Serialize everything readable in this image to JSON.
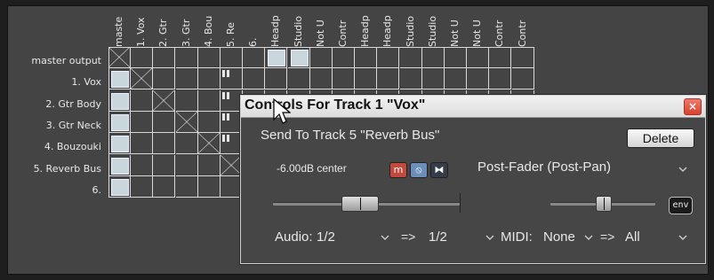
{
  "matrix": {
    "columns": [
      "maste",
      "1. Vox",
      "2. Gtr",
      "3. Gtr",
      "4. Bou",
      "5. Re",
      "6.",
      "Headp",
      "Studio",
      "Not U",
      "Contr",
      "Headp",
      "Headp",
      "Studio",
      "Studio",
      "Not U",
      "Not U",
      "Contr",
      "Contr"
    ],
    "rows": [
      "master output",
      "1. Vox",
      "2. Gtr Body",
      "3. Gtr Neck",
      "4. Bouzouki",
      "5. Reverb Bus",
      "6."
    ]
  },
  "dialog": {
    "title": "Controls For Track 1 \"Vox\"",
    "close_label": "×",
    "send_to": "Send To Track 5 \"Reverb Bus\"",
    "delete_label": "Delete",
    "volume_pan_readout": "-6.00dB center",
    "mute_label": "m",
    "phase_label": "⦸",
    "mono_label": "⧓",
    "send_mode": "Post-Fader (Post-Pan)",
    "env_label": "env",
    "audio_label": "Audio:",
    "audio_source": "1/2",
    "audio_arrow": "=>",
    "audio_dest": "1/2",
    "midi_label": "MIDI:",
    "midi_source": "None",
    "midi_arrow": "=>",
    "midi_dest": "All",
    "volume_level": 0.45,
    "pan_level": 0.5
  },
  "colors": {
    "accent_red": "#d9412c",
    "mute_red": "#c0392b",
    "phase_blue": "#5a7fb0"
  },
  "icons": [
    "close-icon",
    "chevron-down-icon",
    "mouse-pointer-icon",
    "phase-invert-icon",
    "mono-icon"
  ]
}
